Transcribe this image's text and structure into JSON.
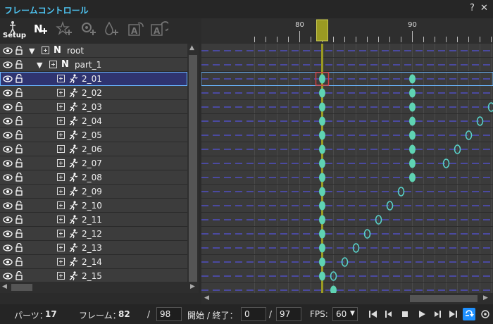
{
  "window": {
    "title": "フレームコントロール",
    "help": "?",
    "close": "✕"
  },
  "toolbar": {
    "setup_label": "Setup"
  },
  "tree": {
    "root": {
      "label": "root",
      "type": "N"
    },
    "part": {
      "label": "part_1",
      "type": "N"
    },
    "items": [
      {
        "label": "2_01",
        "selected": true
      },
      {
        "label": "2_02"
      },
      {
        "label": "2_03"
      },
      {
        "label": "2_04"
      },
      {
        "label": "2_05"
      },
      {
        "label": "2_06"
      },
      {
        "label": "2_07"
      },
      {
        "label": "2_08"
      },
      {
        "label": "2_09"
      },
      {
        "label": "2_10"
      },
      {
        "label": "2_11"
      },
      {
        "label": "2_12"
      },
      {
        "label": "2_13"
      },
      {
        "label": "2_14"
      },
      {
        "label": "2_15"
      }
    ]
  },
  "timeline": {
    "ruler_labels": [
      "80",
      "90"
    ],
    "current_frame": 82,
    "keyframes": [
      [
        82,
        90,
        98,
        99
      ],
      [
        82,
        90,
        99
      ],
      [
        82,
        90,
        97
      ],
      [
        82,
        90,
        96
      ],
      [
        82,
        90,
        95
      ],
      [
        82,
        90,
        94
      ],
      [
        82,
        90,
        93
      ],
      [
        82,
        90
      ],
      [
        82,
        89
      ],
      [
        82,
        88
      ],
      [
        82,
        87
      ],
      [
        82,
        86
      ],
      [
        82,
        85
      ],
      [
        82,
        84
      ],
      [
        82,
        83
      ],
      [
        83
      ]
    ],
    "colors": {
      "filled": "#5fd3b3",
      "outline": "#58d0c8",
      "playhead": "#9a9a22",
      "selected_key": "#d04040"
    }
  },
  "status": {
    "parts_label": "パーツ：",
    "parts_value": "17",
    "frame_label": "フレーム：",
    "frame_value": "82",
    "slash1": "/",
    "total_frames": "98",
    "range_label": "開始 / 終了：",
    "range_start": "0",
    "slash2": "/",
    "range_end": "97",
    "fps_label": "FPS:",
    "fps_value": "60"
  }
}
